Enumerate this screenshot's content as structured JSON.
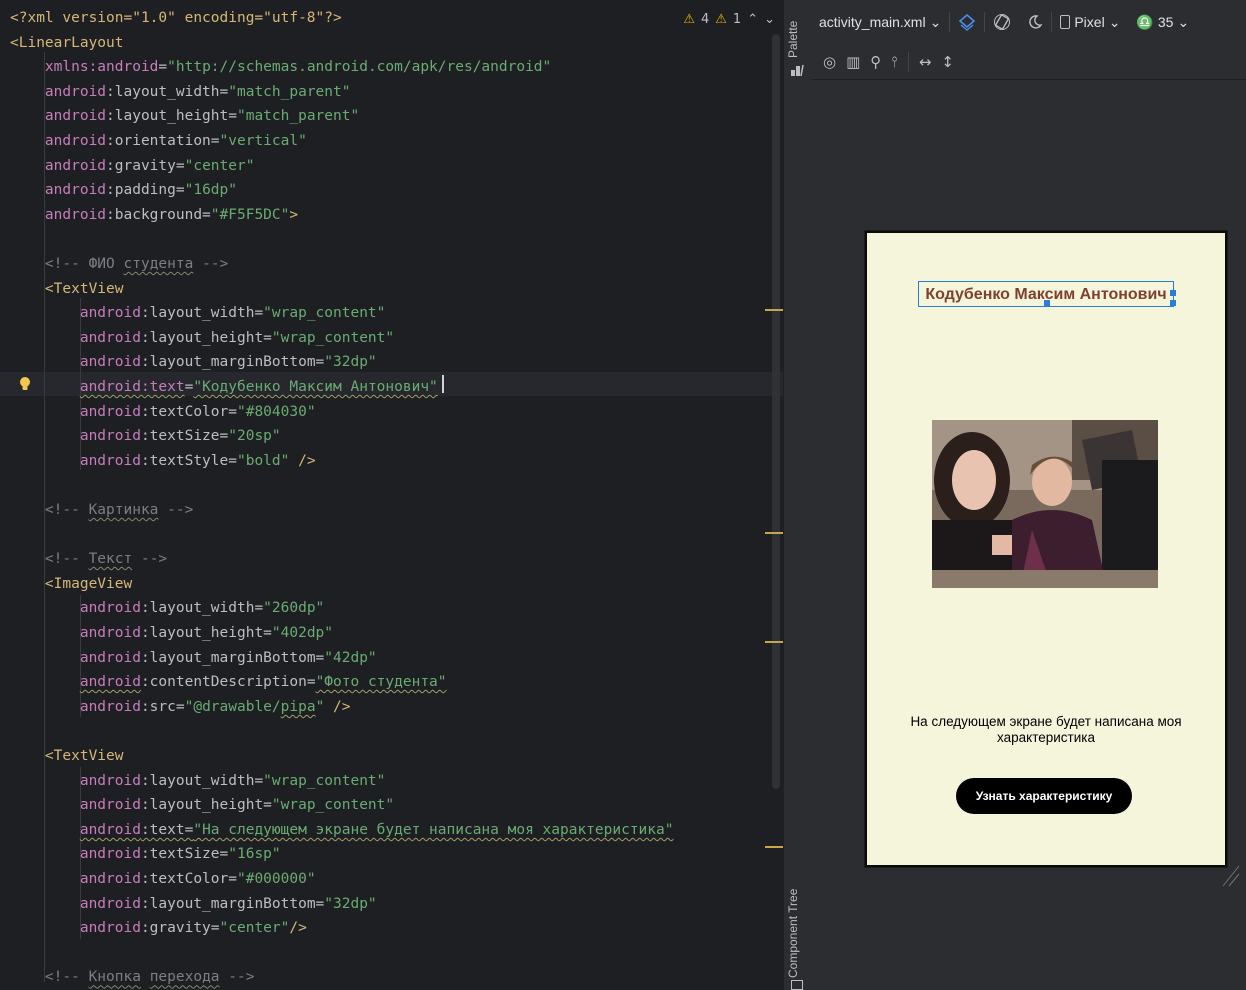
{
  "editor": {
    "warnings": {
      "warn_count": "4",
      "weak_count": "1"
    },
    "lines": [
      {
        "parts": [
          [
            "pi",
            "<?xml version=\"1.0\" encoding=\"utf-8\"?>"
          ]
        ]
      },
      {
        "parts": [
          [
            "tag",
            "<LinearLayout"
          ]
        ]
      },
      {
        "parts": [
          [
            "sp",
            "    "
          ],
          [
            "attrns",
            "xmlns:android"
          ],
          [
            "attr",
            "="
          ],
          [
            "val",
            "\"http://schemas.android.com/apk/res/android\""
          ]
        ]
      },
      {
        "parts": [
          [
            "sp",
            "    "
          ],
          [
            "attrns",
            "android"
          ],
          [
            "attr",
            ":layout_width="
          ],
          [
            "val",
            "\"match_parent\""
          ]
        ]
      },
      {
        "parts": [
          [
            "sp",
            "    "
          ],
          [
            "attrns",
            "android"
          ],
          [
            "attr",
            ":layout_height="
          ],
          [
            "val",
            "\"match_parent\""
          ]
        ]
      },
      {
        "parts": [
          [
            "sp",
            "    "
          ],
          [
            "attrns",
            "android"
          ],
          [
            "attr",
            ":orientation="
          ],
          [
            "val",
            "\"vertical\""
          ]
        ]
      },
      {
        "parts": [
          [
            "sp",
            "    "
          ],
          [
            "attrns",
            "android"
          ],
          [
            "attr",
            ":gravity="
          ],
          [
            "val",
            "\"center\""
          ]
        ]
      },
      {
        "parts": [
          [
            "sp",
            "    "
          ],
          [
            "attrns",
            "android"
          ],
          [
            "attr",
            ":padding="
          ],
          [
            "val",
            "\"16dp\""
          ]
        ]
      },
      {
        "parts": [
          [
            "sp",
            "    "
          ],
          [
            "attrns",
            "android"
          ],
          [
            "attr",
            ":background="
          ],
          [
            "val",
            "\"#F5F5DC\""
          ],
          [
            "tag",
            ">"
          ]
        ]
      },
      {
        "parts": [
          [
            "sp",
            ""
          ]
        ]
      },
      {
        "parts": [
          [
            "sp",
            "    "
          ],
          [
            "cmt",
            "<!-- ФИО "
          ],
          [
            "cmtsq",
            "студента"
          ],
          [
            "cmt",
            " -->"
          ]
        ]
      },
      {
        "parts": [
          [
            "sp",
            "    "
          ],
          [
            "tag",
            "<TextView"
          ]
        ]
      },
      {
        "parts": [
          [
            "sp",
            "        "
          ],
          [
            "attrns",
            "android"
          ],
          [
            "attr",
            ":layout_width="
          ],
          [
            "val",
            "\"wrap_content\""
          ]
        ]
      },
      {
        "parts": [
          [
            "sp",
            "        "
          ],
          [
            "attrns",
            "android"
          ],
          [
            "attr",
            ":layout_height="
          ],
          [
            "val",
            "\"wrap_content\""
          ]
        ]
      },
      {
        "parts": [
          [
            "sp",
            "        "
          ],
          [
            "attrns",
            "android"
          ],
          [
            "attr",
            ":layout_marginBottom="
          ],
          [
            "val",
            "\"32dp\""
          ]
        ]
      },
      {
        "parts": [
          [
            "sp",
            "        "
          ],
          [
            "attrnssq",
            "android:text"
          ],
          [
            "attr",
            "="
          ],
          [
            "valsq",
            "\"Кодубенко Максим Антонович\""
          ]
        ]
      },
      {
        "parts": [
          [
            "sp",
            "        "
          ],
          [
            "attrns",
            "android"
          ],
          [
            "attr",
            ":textColor="
          ],
          [
            "val",
            "\"#804030\""
          ]
        ]
      },
      {
        "parts": [
          [
            "sp",
            "        "
          ],
          [
            "attrns",
            "android"
          ],
          [
            "attr",
            ":textSize="
          ],
          [
            "val",
            "\"20sp\""
          ]
        ]
      },
      {
        "parts": [
          [
            "sp",
            "        "
          ],
          [
            "attrns",
            "android"
          ],
          [
            "attr",
            ":textStyle="
          ],
          [
            "val",
            "\"bold\""
          ],
          [
            "tag",
            " />"
          ]
        ]
      },
      {
        "parts": [
          [
            "sp",
            ""
          ]
        ]
      },
      {
        "parts": [
          [
            "sp",
            "    "
          ],
          [
            "cmt",
            "<!-- "
          ],
          [
            "cmtsq",
            "Картинка"
          ],
          [
            "cmt",
            " -->"
          ]
        ]
      },
      {
        "parts": [
          [
            "sp",
            ""
          ]
        ]
      },
      {
        "parts": [
          [
            "sp",
            "    "
          ],
          [
            "cmt",
            "<!-- "
          ],
          [
            "cmtsq",
            "Текст"
          ],
          [
            "cmt",
            " -->"
          ]
        ]
      },
      {
        "parts": [
          [
            "sp",
            "    "
          ],
          [
            "tag",
            "<ImageView"
          ]
        ]
      },
      {
        "parts": [
          [
            "sp",
            "        "
          ],
          [
            "attrns",
            "android"
          ],
          [
            "attr",
            ":layout_width="
          ],
          [
            "val",
            "\"260dp\""
          ]
        ]
      },
      {
        "parts": [
          [
            "sp",
            "        "
          ],
          [
            "attrns",
            "android"
          ],
          [
            "attr",
            ":layout_height="
          ],
          [
            "val",
            "\"402dp\""
          ]
        ]
      },
      {
        "parts": [
          [
            "sp",
            "        "
          ],
          [
            "attrns",
            "android"
          ],
          [
            "attr",
            ":layout_marginBottom="
          ],
          [
            "val",
            "\"42dp\""
          ]
        ]
      },
      {
        "parts": [
          [
            "sp",
            "        "
          ],
          [
            "attrnssq",
            "android"
          ],
          [
            "attr",
            ":contentDescription="
          ],
          [
            "valsq",
            "\"Фото студента\""
          ]
        ]
      },
      {
        "parts": [
          [
            "sp",
            "        "
          ],
          [
            "attrns",
            "android"
          ],
          [
            "attr",
            ":src="
          ],
          [
            "val",
            "\"@drawable/"
          ],
          [
            "valsq",
            "pipa"
          ],
          [
            "val",
            "\""
          ],
          [
            "tag",
            " />"
          ]
        ]
      },
      {
        "parts": [
          [
            "sp",
            ""
          ]
        ]
      },
      {
        "parts": [
          [
            "sp",
            "    "
          ],
          [
            "tag",
            "<TextView"
          ]
        ]
      },
      {
        "parts": [
          [
            "sp",
            "        "
          ],
          [
            "attrns",
            "android"
          ],
          [
            "attr",
            ":layout_width="
          ],
          [
            "val",
            "\"wrap_content\""
          ]
        ]
      },
      {
        "parts": [
          [
            "sp",
            "        "
          ],
          [
            "attrns",
            "android"
          ],
          [
            "attr",
            ":layout_height="
          ],
          [
            "val",
            "\"wrap_content\""
          ]
        ]
      },
      {
        "parts": [
          [
            "sp",
            "        "
          ],
          [
            "attrnssq",
            "android"
          ],
          [
            "attrsq",
            ":text="
          ],
          [
            "valsq",
            "\"На следующем экране будет написана моя характеристика\""
          ]
        ]
      },
      {
        "parts": [
          [
            "sp",
            "        "
          ],
          [
            "attrns",
            "android"
          ],
          [
            "attr",
            ":textSize="
          ],
          [
            "val",
            "\"16sp\""
          ]
        ]
      },
      {
        "parts": [
          [
            "sp",
            "        "
          ],
          [
            "attrns",
            "android"
          ],
          [
            "attr",
            ":textColor="
          ],
          [
            "val",
            "\"#000000\""
          ]
        ]
      },
      {
        "parts": [
          [
            "sp",
            "        "
          ],
          [
            "attrns",
            "android"
          ],
          [
            "attr",
            ":layout_marginBottom="
          ],
          [
            "val",
            "\"32dp\""
          ]
        ]
      },
      {
        "parts": [
          [
            "sp",
            "        "
          ],
          [
            "attrns",
            "android"
          ],
          [
            "attr",
            ":gravity="
          ],
          [
            "val",
            "\"center\""
          ],
          [
            "tag",
            "/>"
          ]
        ]
      },
      {
        "parts": [
          [
            "sp",
            ""
          ]
        ]
      },
      {
        "parts": [
          [
            "sp",
            "    "
          ],
          [
            "cmt",
            "<!-- "
          ],
          [
            "cmtsq",
            "Кнопка"
          ],
          [
            "cmt",
            " "
          ],
          [
            "cmtsq",
            "перехода"
          ],
          [
            "cmt",
            " -->"
          ]
        ]
      }
    ]
  },
  "side_strip": {
    "palette_label": "Palette",
    "component_tree_label": "Component Tree"
  },
  "design": {
    "file_name": "activity_main.xml",
    "device": "Pixel",
    "api_level": "35",
    "preview": {
      "background": "#F5F5DC",
      "name_text": "Кодубенко Максим Антонович",
      "name_color": "#804030",
      "description_text": "На следующем экране будет написана моя характеристика",
      "button_label": "Узнать характеристику"
    }
  }
}
